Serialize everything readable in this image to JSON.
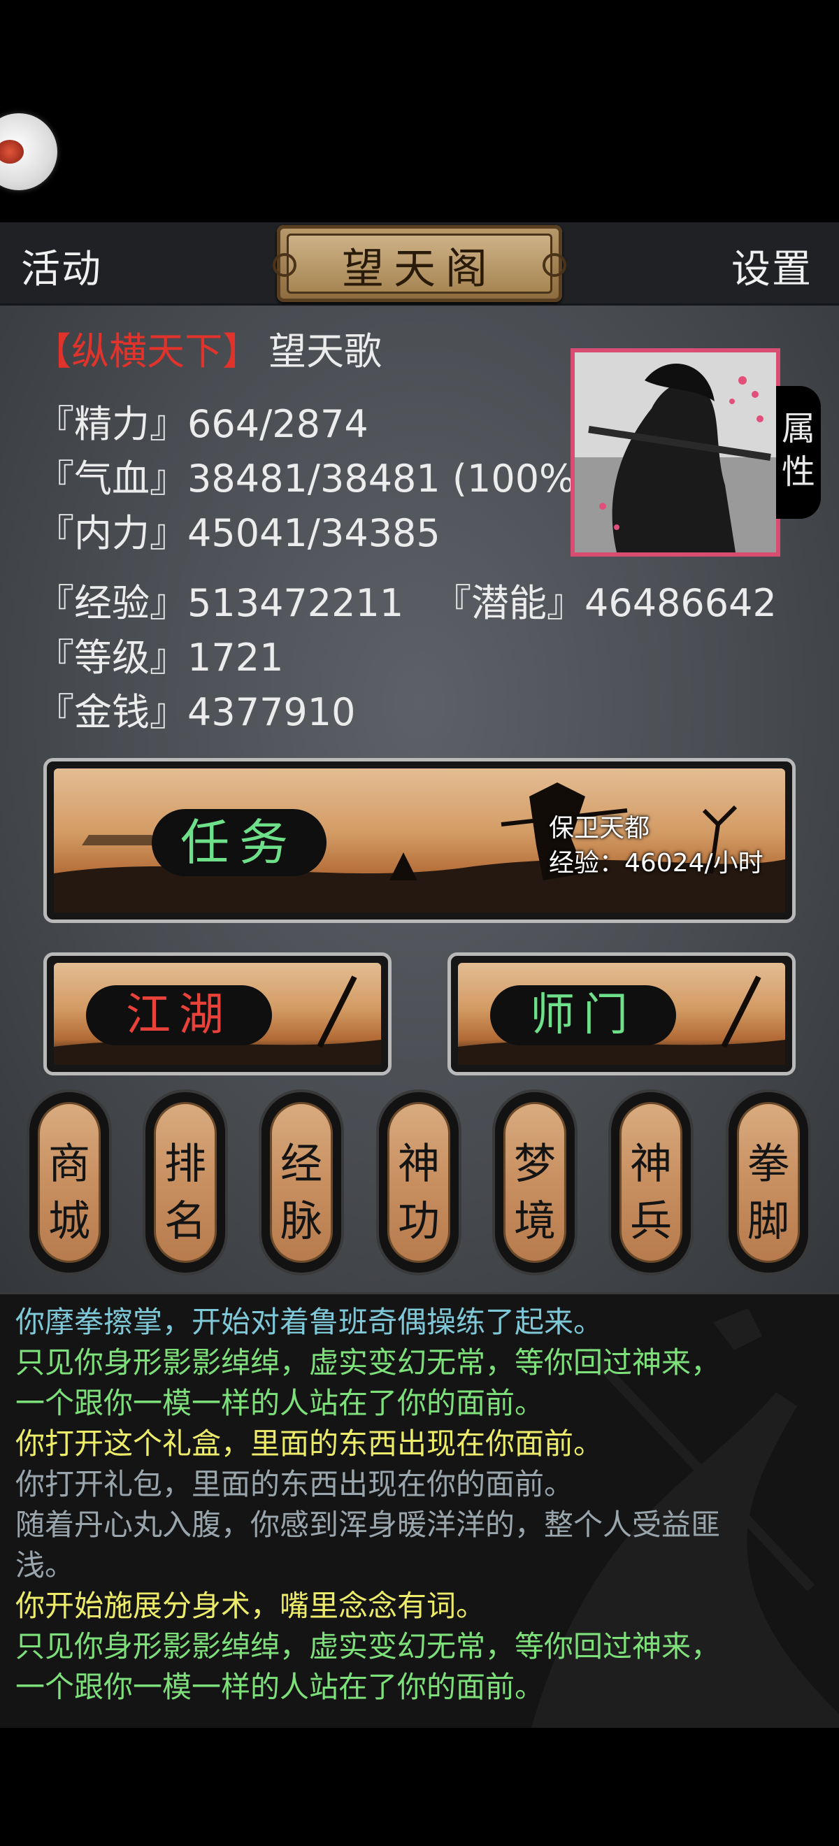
{
  "header": {
    "left_label": "活动",
    "title": "望天阁",
    "right_label": "设置"
  },
  "player": {
    "faction": "【纵横天下】",
    "name": "望天歌",
    "energy": "『精力』664/2874",
    "hp": "『气血』38481/38481 (100%)",
    "inner_power": "『内力』45041/34385",
    "exp": "『经验』513472211",
    "potential": "『潜能』46486642",
    "level": "『等级』1721",
    "money": "『金钱』4377910",
    "attr_line1": "属",
    "attr_line2": "性"
  },
  "quest": {
    "label": "任务",
    "name": "保卫天都",
    "rate": "经验：46024/小时"
  },
  "jianghu": {
    "label": "江湖"
  },
  "shimen": {
    "label": "师门"
  },
  "skills": [
    {
      "top": "商",
      "bottom": "城"
    },
    {
      "top": "排",
      "bottom": "名"
    },
    {
      "top": "经",
      "bottom": "脉"
    },
    {
      "top": "神",
      "bottom": "功"
    },
    {
      "top": "梦",
      "bottom": "境"
    },
    {
      "top": "神",
      "bottom": "兵"
    },
    {
      "top": "拳",
      "bottom": "脚"
    }
  ],
  "log": [
    {
      "text": "你摩拳擦掌，开始对着鲁班奇偶操练了起来。",
      "color": "#7ec8d8"
    },
    {
      "text": "只见你身形影影绰绰，虚实变幻无常，等你回过神来，",
      "color": "#7de07a"
    },
    {
      "text": "一个跟你一模一样的人站在了你的面前。",
      "color": "#7de07a"
    },
    {
      "text": "你打开这个礼盒，里面的东西出现在你面前。",
      "color": "#ecec6a"
    },
    {
      "text": "你打开礼包，里面的东西出现在你的面前。",
      "color": "#9aa6ad"
    },
    {
      "text": "随着丹心丸入腹，你感到浑身暖洋洋的，整个人受益匪",
      "color": "#9aa6ad"
    },
    {
      "text": "浅。",
      "color": "#9aa6ad"
    },
    {
      "text": "你开始施展分身术，嘴里念念有词。",
      "color": "#ecec6a"
    },
    {
      "text": "只见你身形影影绰绰，虚实变幻无常，等你回过神来，",
      "color": "#7de07a"
    },
    {
      "text": "一个跟你一模一样的人站在了你的面前。",
      "color": "#7de07a"
    }
  ]
}
